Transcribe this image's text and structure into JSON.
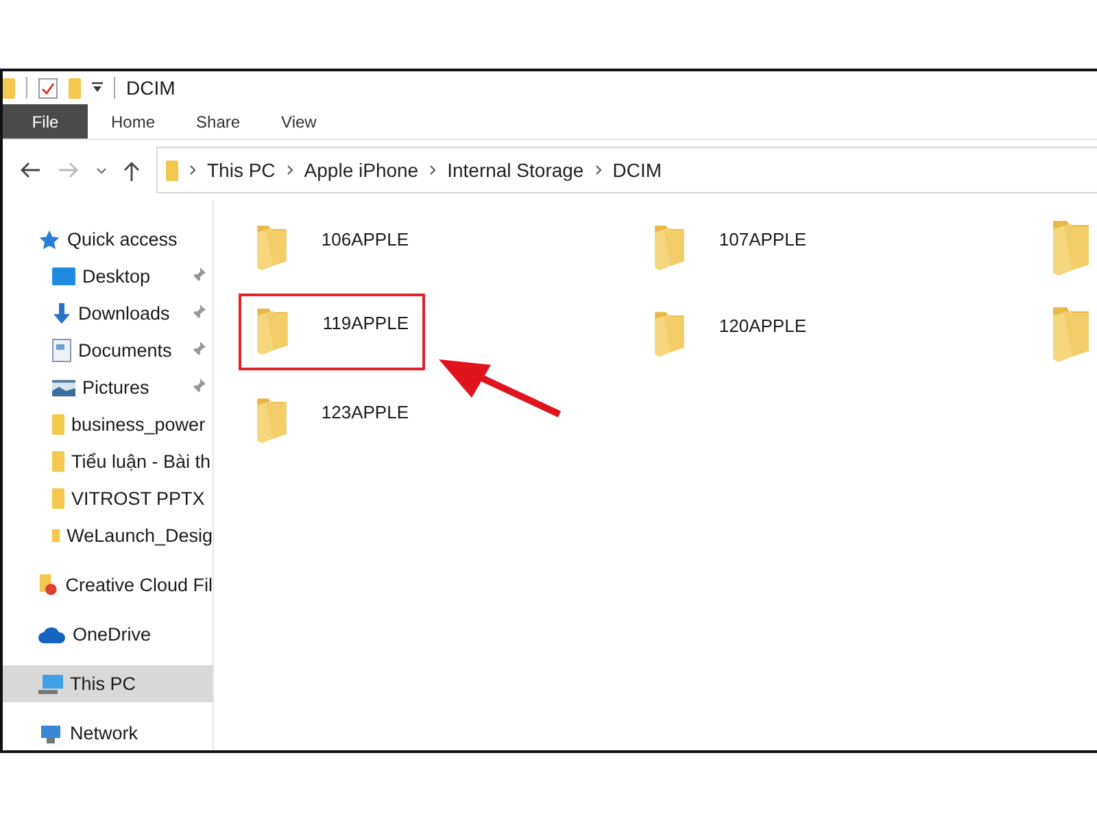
{
  "window": {
    "title": "DCIM"
  },
  "ribbon_tabs": [
    {
      "label": "File",
      "kind": "file"
    },
    {
      "label": "Home",
      "kind": "tab"
    },
    {
      "label": "Share",
      "kind": "tab"
    },
    {
      "label": "View",
      "kind": "tab"
    }
  ],
  "address_bar": {
    "path": [
      "This PC",
      "Apple iPhone",
      "Internal Storage",
      "DCIM"
    ]
  },
  "sidebar": {
    "items": [
      {
        "label": "Quick access",
        "kind": "quick-access",
        "pinned": false,
        "selected": false
      },
      {
        "label": "Desktop",
        "kind": "desktop",
        "pinned": true,
        "selected": false
      },
      {
        "label": "Downloads",
        "kind": "downloads",
        "pinned": true,
        "selected": false
      },
      {
        "label": "Documents",
        "kind": "documents",
        "pinned": true,
        "selected": false
      },
      {
        "label": "Pictures",
        "kind": "pictures",
        "pinned": true,
        "selected": false
      },
      {
        "label": "business_power",
        "kind": "folder",
        "pinned": false,
        "selected": false
      },
      {
        "label": "Tiểu luận - Bài th",
        "kind": "folder",
        "pinned": false,
        "selected": false
      },
      {
        "label": "VITROST PPTX",
        "kind": "folder",
        "pinned": false,
        "selected": false
      },
      {
        "label": "WeLaunch_Desig",
        "kind": "folder",
        "pinned": false,
        "selected": false
      },
      {
        "label": "Creative Cloud Fil",
        "kind": "creative-cloud",
        "pinned": false,
        "selected": false
      },
      {
        "label": "OneDrive",
        "kind": "onedrive",
        "pinned": false,
        "selected": false
      },
      {
        "label": "This PC",
        "kind": "pc",
        "pinned": false,
        "selected": true
      },
      {
        "label": "Network",
        "kind": "network",
        "pinned": false,
        "selected": false
      }
    ]
  },
  "folders": [
    {
      "label": "106APPLE",
      "highlighted": false
    },
    {
      "label": "107APPLE",
      "highlighted": false
    },
    {
      "highlighted": false
    },
    {
      "label": "119APPLE",
      "highlighted": true
    },
    {
      "label": "120APPLE",
      "highlighted": false
    },
    {
      "highlighted": false
    },
    {
      "label": "123APPLE",
      "highlighted": false
    }
  ]
}
